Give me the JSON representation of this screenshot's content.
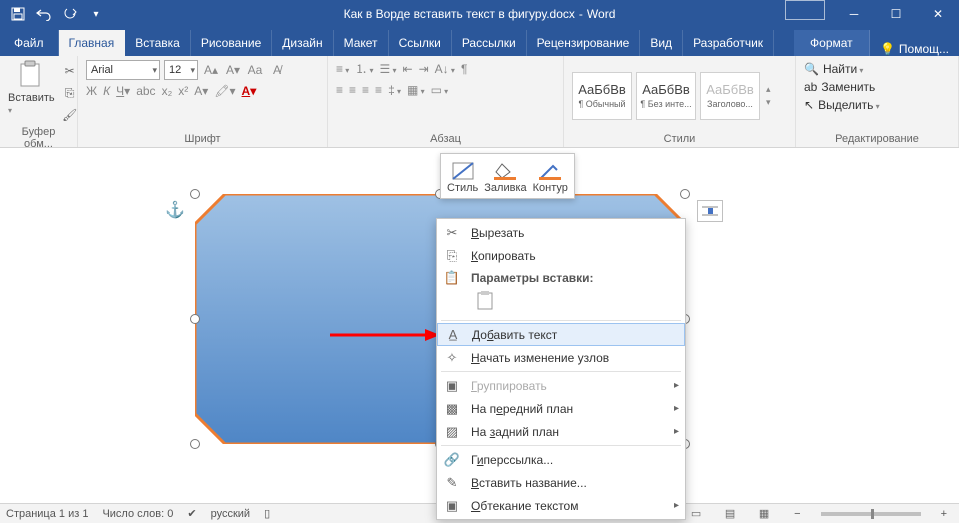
{
  "titlebar": {
    "doc_title": "Как в Ворде вставить текст в фигуру.docx",
    "app_name": "Word",
    "sep": "-"
  },
  "tabs": {
    "file": "Файл",
    "home": "Главная",
    "insert": "Вставка",
    "draw": "Рисование",
    "design": "Дизайн",
    "layout": "Макет",
    "references": "Ссылки",
    "mailings": "Рассылки",
    "review": "Рецензирование",
    "view": "Вид",
    "developer": "Разработчик",
    "format": "Формат",
    "tell_me": "Помощ..."
  },
  "ribbon": {
    "clipboard": {
      "paste": "Вставить",
      "group": "Буфер обм..."
    },
    "font": {
      "name": "Arial",
      "size": "12",
      "group": "Шрифт"
    },
    "paragraph": {
      "group": "Абзац"
    },
    "styles": {
      "preview": "АаБбВв",
      "s1": "¶ Обычный",
      "s2": "¶ Без инте...",
      "s3": "Заголово...",
      "group": "Стили"
    },
    "editing": {
      "find": "Найти",
      "replace": "Заменить",
      "select": "Выделить",
      "group": "Редактирование"
    }
  },
  "minitoolbar": {
    "style": "Стиль",
    "fill": "Заливка",
    "outline": "Контур"
  },
  "context": {
    "cut": "Вырезать",
    "copy": "Копировать",
    "paste_options": "Параметры вставки:",
    "add_text": "Добавить текст",
    "edit_points": "Начать изменение узлов",
    "group": "Группировать",
    "bring_front": "На передний план",
    "send_back": "На задний план",
    "hyperlink": "Гиперссылка...",
    "caption": "Вставить название...",
    "wrap": "Обтекание текстом"
  },
  "statusbar": {
    "page": "Страница 1 из 1",
    "words": "Число слов: 0",
    "lang": "русский",
    "zoom_minus": "−",
    "zoom_plus": "+"
  },
  "colors": {
    "accent": "#2b579a",
    "shape_fill_top": "#8fb4dd",
    "shape_fill_bottom": "#4f86c6",
    "shape_border": "#ed7d31",
    "arrow": "#ff0000"
  }
}
